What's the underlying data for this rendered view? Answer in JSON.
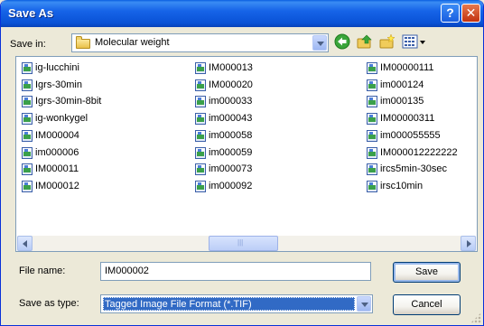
{
  "window": {
    "title": "Save As",
    "help_glyph": "?",
    "close_glyph": "✕"
  },
  "toolbar": {
    "save_in_label": "Save in:",
    "current_folder": "Molecular weight"
  },
  "files": {
    "column1": [
      "ig-lucchini",
      "Igrs-30min",
      "Igrs-30min-8bit",
      "ig-wonkygel",
      "IM000004",
      "im000006",
      "IM000011",
      "IM000012"
    ],
    "column2": [
      "IM000013",
      "IM000020",
      "im000033",
      "im000043",
      "im000058",
      "im000059",
      "im000073",
      "im000092"
    ],
    "column3": [
      "IM00000111",
      "im000124",
      "im000135",
      "IM00000311",
      "im000055555",
      "IM000012222222",
      "ircs5min-30sec",
      "irsc10min"
    ]
  },
  "form": {
    "file_name_label": "File name:",
    "file_name_value": "IM000002",
    "save_as_type_label": "Save as type:",
    "save_as_type_value": "Tagged Image File Format (*.TIF)"
  },
  "buttons": {
    "save": "Save",
    "cancel": "Cancel"
  },
  "colors": {
    "title_bar": "#0a52d6",
    "selection": "#316ac5",
    "dialog_bg": "#ece9d8"
  }
}
